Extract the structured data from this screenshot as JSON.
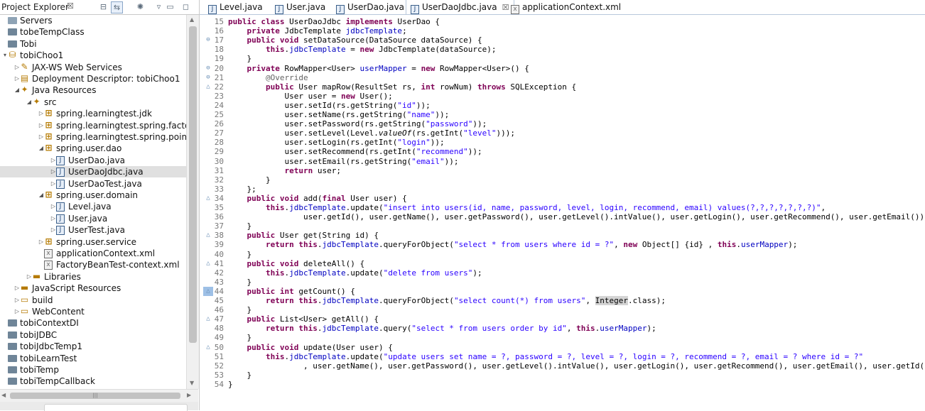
{
  "project_explorer": {
    "title": "Project Explorer",
    "tree": [
      {
        "label": "Servers",
        "depth": 0,
        "icon": "folder-open-icon",
        "twisty": ""
      },
      {
        "label": "tobeTempClass",
        "depth": 0,
        "icon": "project-closed-icon",
        "twisty": ""
      },
      {
        "label": "Tobi",
        "depth": 0,
        "icon": "project-closed-icon",
        "twisty": ""
      },
      {
        "label": "tobiChoo1",
        "depth": 0,
        "icon": "web-project-icon",
        "twisty": "▾"
      },
      {
        "label": "JAX-WS Web Services",
        "depth": 1,
        "icon": "web-services-icon",
        "twisty": "▷"
      },
      {
        "label": "Deployment Descriptor: tobiChoo1",
        "depth": 1,
        "icon": "deployment-descriptor-icon",
        "twisty": "▷"
      },
      {
        "label": "Java Resources",
        "depth": 1,
        "icon": "java-resources-icon",
        "twisty": "◢"
      },
      {
        "label": "src",
        "depth": 2,
        "icon": "source-folder-icon",
        "twisty": "◢"
      },
      {
        "label": "spring.learningtest.jdk",
        "depth": 3,
        "icon": "package-icon",
        "twisty": "▷"
      },
      {
        "label": "spring.learningtest.spring.factorybean",
        "depth": 3,
        "icon": "package-icon",
        "twisty": "▷"
      },
      {
        "label": "spring.learningtest.spring.pointcut",
        "depth": 3,
        "icon": "package-icon",
        "twisty": "▷"
      },
      {
        "label": "spring.user.dao",
        "depth": 3,
        "icon": "package-icon",
        "twisty": "◢"
      },
      {
        "label": "UserDao.java",
        "depth": 4,
        "icon": "java-file-icon",
        "twisty": "▷"
      },
      {
        "label": "UserDaoJdbc.java",
        "depth": 4,
        "icon": "java-file-icon",
        "twisty": "▷",
        "selected": true
      },
      {
        "label": "UserDaoTest.java",
        "depth": 4,
        "icon": "java-file-icon",
        "twisty": "▷"
      },
      {
        "label": "spring.user.domain",
        "depth": 3,
        "icon": "package-icon",
        "twisty": "◢"
      },
      {
        "label": "Level.java",
        "depth": 4,
        "icon": "java-file-icon",
        "twisty": "▷"
      },
      {
        "label": "User.java",
        "depth": 4,
        "icon": "java-file-icon",
        "twisty": "▷"
      },
      {
        "label": "UserTest.java",
        "depth": 4,
        "icon": "java-file-icon",
        "twisty": "▷"
      },
      {
        "label": "spring.user.service",
        "depth": 3,
        "icon": "package-icon",
        "twisty": "▷"
      },
      {
        "label": "applicationContext.xml",
        "depth": 3,
        "icon": "xml-file-icon",
        "twisty": ""
      },
      {
        "label": "FactoryBeanTest-context.xml",
        "depth": 3,
        "icon": "xml-file-icon",
        "twisty": ""
      },
      {
        "label": "Libraries",
        "depth": 2,
        "icon": "libraries-icon",
        "twisty": "▷"
      },
      {
        "label": "JavaScript Resources",
        "depth": 1,
        "icon": "javascript-resources-icon",
        "twisty": "▷"
      },
      {
        "label": "build",
        "depth": 1,
        "icon": "folder-icon",
        "twisty": "▷"
      },
      {
        "label": "WebContent",
        "depth": 1,
        "icon": "folder-icon",
        "twisty": "▷"
      },
      {
        "label": "tobiContextDI",
        "depth": 0,
        "icon": "project-closed-icon",
        "twisty": ""
      },
      {
        "label": "tobiJDBC",
        "depth": 0,
        "icon": "project-closed-icon",
        "twisty": ""
      },
      {
        "label": "tobiJdbcTemp1",
        "depth": 0,
        "icon": "project-closed-icon",
        "twisty": ""
      },
      {
        "label": "tobiLearnTest",
        "depth": 0,
        "icon": "project-closed-icon",
        "twisty": ""
      },
      {
        "label": "tobiTemp",
        "depth": 0,
        "icon": "project-closed-icon",
        "twisty": ""
      },
      {
        "label": "tobiTempCallback",
        "depth": 0,
        "icon": "project-closed-icon",
        "twisty": ""
      }
    ]
  },
  "editor": {
    "tabs": [
      {
        "label": "Level.java",
        "icon": "java-file-icon",
        "active": false
      },
      {
        "label": "User.java",
        "icon": "java-file-icon",
        "active": false
      },
      {
        "label": "UserDao.java",
        "icon": "java-file-icon",
        "active": false
      },
      {
        "label": "UserDaoJdbc.java",
        "icon": "java-file-icon",
        "active": true
      },
      {
        "label": "applicationContext.xml",
        "icon": "xml-file-icon",
        "active": false
      }
    ],
    "lines": [
      {
        "n": "15",
        "m": "",
        "s": [
          [
            "k",
            "public"
          ],
          [
            "t",
            " "
          ],
          [
            "k",
            "class"
          ],
          [
            "t",
            " UserDaoJdbc "
          ],
          [
            "k",
            "implements"
          ],
          [
            "t",
            " UserDao {"
          ]
        ]
      },
      {
        "n": "16",
        "m": "",
        "s": [
          [
            "t",
            "    "
          ],
          [
            "k",
            "private"
          ],
          [
            "t",
            " JdbcTemplate "
          ],
          [
            "f",
            "jdbcTemplate"
          ],
          [
            "t",
            ";"
          ]
        ]
      },
      {
        "n": "17",
        "m": "⊖",
        "s": [
          [
            "t",
            "    "
          ],
          [
            "k",
            "public"
          ],
          [
            "t",
            " "
          ],
          [
            "k",
            "void"
          ],
          [
            "t",
            " setDataSource(DataSource dataSource) {"
          ]
        ]
      },
      {
        "n": "18",
        "m": "",
        "s": [
          [
            "t",
            "        "
          ],
          [
            "k",
            "this"
          ],
          [
            "t",
            "."
          ],
          [
            "f",
            "jdbcTemplate"
          ],
          [
            "t",
            " = "
          ],
          [
            "k",
            "new"
          ],
          [
            "t",
            " JdbcTemplate(dataSource);"
          ]
        ]
      },
      {
        "n": "19",
        "m": "",
        "s": [
          [
            "t",
            "    }"
          ]
        ]
      },
      {
        "n": "20",
        "m": "⊖",
        "s": [
          [
            "t",
            "    "
          ],
          [
            "k",
            "private"
          ],
          [
            "t",
            " RowMapper<User> "
          ],
          [
            "f",
            "userMapper"
          ],
          [
            "t",
            " = "
          ],
          [
            "k",
            "new"
          ],
          [
            "t",
            " RowMapper<User>() {"
          ]
        ]
      },
      {
        "n": "21",
        "m": "⊖",
        "s": [
          [
            "t",
            "        "
          ],
          [
            "a",
            "@Override"
          ]
        ]
      },
      {
        "n": "22",
        "m": "△",
        "s": [
          [
            "t",
            "        "
          ],
          [
            "k",
            "public"
          ],
          [
            "t",
            " User mapRow(ResultSet rs, "
          ],
          [
            "k",
            "int"
          ],
          [
            "t",
            " rowNum) "
          ],
          [
            "k",
            "throws"
          ],
          [
            "t",
            " SQLException {"
          ]
        ]
      },
      {
        "n": "23",
        "m": "",
        "s": [
          [
            "t",
            "            User user = "
          ],
          [
            "k",
            "new"
          ],
          [
            "t",
            " User();"
          ]
        ]
      },
      {
        "n": "24",
        "m": "",
        "s": [
          [
            "t",
            "            user.setId(rs.getString("
          ],
          [
            "q",
            "\"id\""
          ],
          [
            "t",
            "));"
          ]
        ]
      },
      {
        "n": "25",
        "m": "",
        "s": [
          [
            "t",
            "            user.setName(rs.getString("
          ],
          [
            "q",
            "\"name\""
          ],
          [
            "t",
            "));"
          ]
        ]
      },
      {
        "n": "26",
        "m": "",
        "s": [
          [
            "t",
            "            user.setPassword(rs.getString("
          ],
          [
            "q",
            "\"password\""
          ],
          [
            "t",
            "));"
          ]
        ]
      },
      {
        "n": "27",
        "m": "",
        "s": [
          [
            "t",
            "            user.setLevel(Level."
          ],
          [
            "i",
            "valueOf"
          ],
          [
            "t",
            "(rs.getInt("
          ],
          [
            "q",
            "\"level\""
          ],
          [
            "t",
            ")));"
          ]
        ]
      },
      {
        "n": "28",
        "m": "",
        "s": [
          [
            "t",
            "            user.setLogin(rs.getInt("
          ],
          [
            "q",
            "\"login\""
          ],
          [
            "t",
            "));"
          ]
        ]
      },
      {
        "n": "29",
        "m": "",
        "s": [
          [
            "t",
            "            user.setRecommend(rs.getInt("
          ],
          [
            "q",
            "\"recommend\""
          ],
          [
            "t",
            "));"
          ]
        ]
      },
      {
        "n": "30",
        "m": "",
        "s": [
          [
            "t",
            "            user.setEmail(rs.getString("
          ],
          [
            "q",
            "\"email\""
          ],
          [
            "t",
            "));"
          ]
        ]
      },
      {
        "n": "31",
        "m": "",
        "s": [
          [
            "t",
            "            "
          ],
          [
            "k",
            "return"
          ],
          [
            "t",
            " user;"
          ]
        ]
      },
      {
        "n": "32",
        "m": "",
        "s": [
          [
            "t",
            "        }"
          ]
        ]
      },
      {
        "n": "33",
        "m": "",
        "s": [
          [
            "t",
            "    };"
          ]
        ]
      },
      {
        "n": "34",
        "m": "△",
        "s": [
          [
            "t",
            "    "
          ],
          [
            "k",
            "public"
          ],
          [
            "t",
            " "
          ],
          [
            "k",
            "void"
          ],
          [
            "t",
            " add("
          ],
          [
            "k",
            "final"
          ],
          [
            "t",
            " User user) {"
          ]
        ]
      },
      {
        "n": "35",
        "m": "",
        "s": [
          [
            "t",
            "        "
          ],
          [
            "k",
            "this"
          ],
          [
            "t",
            "."
          ],
          [
            "f",
            "jdbcTemplate"
          ],
          [
            "t",
            ".update("
          ],
          [
            "q",
            "\"insert into users(id, name, password, level, login, recommend, email) values(?,?,?,?,?,?,?)\""
          ],
          [
            "t",
            ","
          ]
        ]
      },
      {
        "n": "36",
        "m": "",
        "s": [
          [
            "t",
            "                user.getId(), user.getName(), user.getPassword(), user.getLevel().intValue(), user.getLogin(), user.getRecommend(), user.getEmail());"
          ]
        ]
      },
      {
        "n": "37",
        "m": "",
        "s": [
          [
            "t",
            "    }"
          ]
        ]
      },
      {
        "n": "38",
        "m": "△",
        "s": [
          [
            "t",
            "    "
          ],
          [
            "k",
            "public"
          ],
          [
            "t",
            " User get(String id) {"
          ]
        ]
      },
      {
        "n": "39",
        "m": "",
        "s": [
          [
            "t",
            "        "
          ],
          [
            "k",
            "return"
          ],
          [
            "t",
            " "
          ],
          [
            "k",
            "this"
          ],
          [
            "t",
            "."
          ],
          [
            "f",
            "jdbcTemplate"
          ],
          [
            "t",
            ".queryForObject("
          ],
          [
            "q",
            "\"select * from users where id = ?\""
          ],
          [
            "t",
            ", "
          ],
          [
            "k",
            "new"
          ],
          [
            "t",
            " Object[] {id} , "
          ],
          [
            "k",
            "this"
          ],
          [
            "t",
            "."
          ],
          [
            "f",
            "userMapper"
          ],
          [
            "t",
            ");"
          ]
        ]
      },
      {
        "n": "40",
        "m": "",
        "s": [
          [
            "t",
            "    }"
          ]
        ]
      },
      {
        "n": "41",
        "m": "△",
        "s": [
          [
            "t",
            "    "
          ],
          [
            "k",
            "public"
          ],
          [
            "t",
            " "
          ],
          [
            "k",
            "void"
          ],
          [
            "t",
            " deleteAll() {"
          ]
        ]
      },
      {
        "n": "42",
        "m": "",
        "s": [
          [
            "t",
            "        "
          ],
          [
            "k",
            "this"
          ],
          [
            "t",
            "."
          ],
          [
            "f",
            "jdbcTemplate"
          ],
          [
            "t",
            ".update("
          ],
          [
            "q",
            "\"delete from users\""
          ],
          [
            "t",
            ");"
          ]
        ]
      },
      {
        "n": "43",
        "m": "",
        "s": [
          [
            "t",
            "    }"
          ]
        ]
      },
      {
        "n": "44",
        "m": "△",
        "box": true,
        "s": [
          [
            "t",
            "    "
          ],
          [
            "k",
            "public"
          ],
          [
            "t",
            " "
          ],
          [
            "k",
            "int"
          ],
          [
            "t",
            " getCount() {"
          ]
        ]
      },
      {
        "n": "45",
        "m": "",
        "box": true,
        "s": [
          [
            "t",
            "        "
          ],
          [
            "k",
            "return"
          ],
          [
            "t",
            " "
          ],
          [
            "k",
            "this"
          ],
          [
            "t",
            "."
          ],
          [
            "f",
            "jdbcTemplate"
          ],
          [
            "t",
            ".queryForObject("
          ],
          [
            "q",
            "\"select count(*) from users\""
          ],
          [
            "t",
            ", "
          ],
          [
            "h",
            "Integer"
          ],
          [
            "t",
            ".class);"
          ]
        ]
      },
      {
        "n": "46",
        "m": "",
        "box": true,
        "s": [
          [
            "t",
            "    }"
          ]
        ]
      },
      {
        "n": "47",
        "m": "△",
        "s": [
          [
            "t",
            "    "
          ],
          [
            "k",
            "public"
          ],
          [
            "t",
            " List<User> getAll() {"
          ]
        ]
      },
      {
        "n": "48",
        "m": "",
        "s": [
          [
            "t",
            "        "
          ],
          [
            "k",
            "return"
          ],
          [
            "t",
            " "
          ],
          [
            "k",
            "this"
          ],
          [
            "t",
            "."
          ],
          [
            "f",
            "jdbcTemplate"
          ],
          [
            "t",
            ".query("
          ],
          [
            "q",
            "\"select * from users order by id\""
          ],
          [
            "t",
            ", "
          ],
          [
            "k",
            "this"
          ],
          [
            "t",
            "."
          ],
          [
            "f",
            "userMapper"
          ],
          [
            "t",
            ");"
          ]
        ]
      },
      {
        "n": "49",
        "m": "",
        "s": [
          [
            "t",
            "    }"
          ]
        ]
      },
      {
        "n": "50",
        "m": "△",
        "s": [
          [
            "t",
            "    "
          ],
          [
            "k",
            "public"
          ],
          [
            "t",
            " "
          ],
          [
            "k",
            "void"
          ],
          [
            "t",
            " update(User user) {"
          ]
        ]
      },
      {
        "n": "51",
        "m": "",
        "s": [
          [
            "t",
            "        "
          ],
          [
            "k",
            "this"
          ],
          [
            "t",
            "."
          ],
          [
            "f",
            "jdbcTemplate"
          ],
          [
            "t",
            ".update("
          ],
          [
            "q",
            "\"update users set name = ?, password = ?, level = ?, login = ?, recommend = ?, email = ? where id = ?\""
          ]
        ]
      },
      {
        "n": "52",
        "m": "",
        "s": [
          [
            "t",
            "                , user.getName(), user.getPassword(), user.getLevel().intValue(), user.getLogin(), user.getRecommend(), user.getEmail(), user.getId());"
          ]
        ]
      },
      {
        "n": "53",
        "m": "",
        "s": [
          [
            "t",
            "    }"
          ]
        ]
      },
      {
        "n": "54",
        "m": "",
        "s": [
          [
            "t",
            "}"
          ]
        ]
      }
    ]
  },
  "colors": {
    "keyword": "#7f0055",
    "field": "#0000c0",
    "string": "#2a00ff",
    "annotation": "#646464",
    "line_number": "#787878"
  }
}
